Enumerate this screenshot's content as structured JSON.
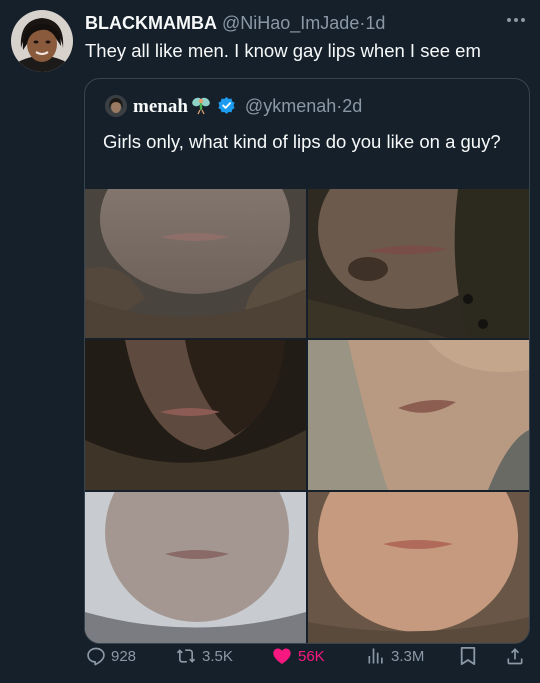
{
  "tweet": {
    "display_name": "BLACKMAMBA",
    "handle": "@NiHao_ImJade",
    "separator": "·",
    "time": "1d",
    "text": "They all like men. I know gay lips when I see em"
  },
  "quoted": {
    "display_name": "menah",
    "handle": "@ykmenah",
    "separator": "·",
    "time": "2d",
    "text": "Girls only, what kind of lips do you like on a guy?",
    "media_count": 6
  },
  "actions": {
    "replies": "928",
    "reposts": "3.5K",
    "likes": "56K",
    "views": "3.3M"
  },
  "colors": {
    "background": "#15202b",
    "text": "#f7f9f9",
    "muted": "#8b98a5",
    "border": "#38444d",
    "like": "#f91880",
    "verified": "#1d9bf0"
  },
  "icons": [
    "more-icon",
    "verified-badge-icon",
    "fairy-emoji-icon",
    "reply-icon",
    "repost-icon",
    "like-icon",
    "views-icon",
    "bookmark-icon",
    "share-icon"
  ]
}
